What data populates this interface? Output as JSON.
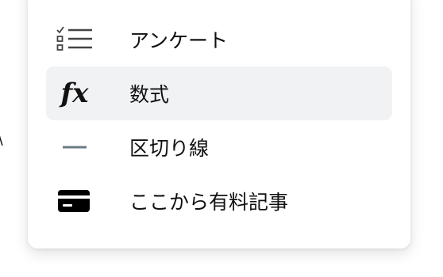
{
  "menu": {
    "items": [
      {
        "label": "アンケート",
        "icon": "checklist-icon",
        "active": false
      },
      {
        "label": "数式",
        "icon": "function-fx-icon",
        "icon_text": "fx",
        "active": true
      },
      {
        "label": "区切り線",
        "icon": "divider-line-icon",
        "active": false
      },
      {
        "label": "ここから有料記事",
        "icon": "paywall-card-icon",
        "active": false
      }
    ]
  },
  "colors": {
    "hover_background": "#f1f2f4",
    "text": "#111111",
    "divider_icon": "#6b7b82"
  }
}
